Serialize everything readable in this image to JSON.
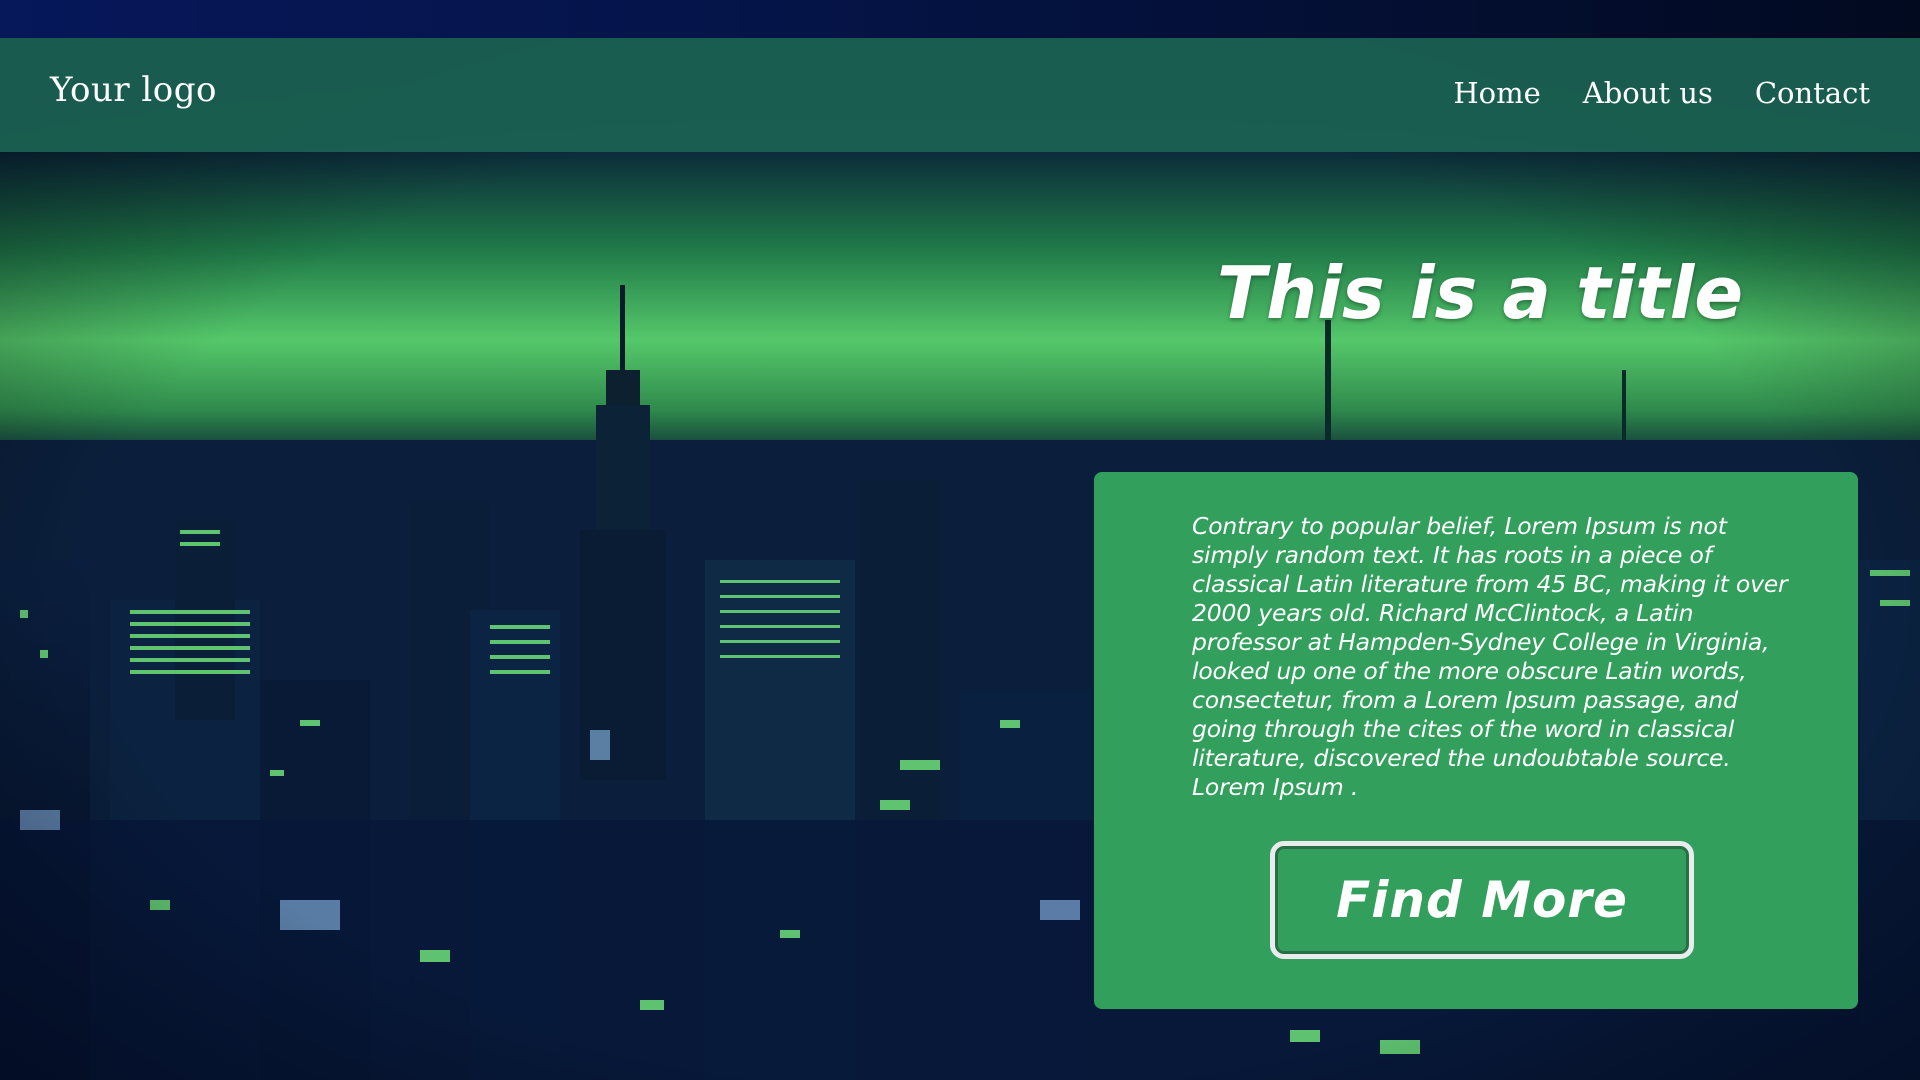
{
  "header": {
    "logo": "Your logo",
    "nav": [
      {
        "label": "Home"
      },
      {
        "label": "About us"
      },
      {
        "label": "Contact"
      }
    ]
  },
  "hero": {
    "title": "This is a title",
    "body": "Contrary to popular belief, Lorem Ipsum is not simply random text. It has roots in a piece of classical Latin literature from 45 BC, making it over 2000 years old. Richard McClintock, a Latin professor at Hampden-Sydney College in Virginia, looked up one of the more obscure Latin words, consectetur, from a Lorem Ipsum passage, and going through the cites of the word in classical literature, discovered the undoubtable source. Lorem Ipsum .",
    "button_label": "Find More"
  },
  "background": {
    "icon": "city-skyline-night-image"
  },
  "colors": {
    "header_bg": "#1b6353",
    "card_bg": "#32a05c",
    "text": "#ffffff",
    "glow": "#55c86a"
  }
}
